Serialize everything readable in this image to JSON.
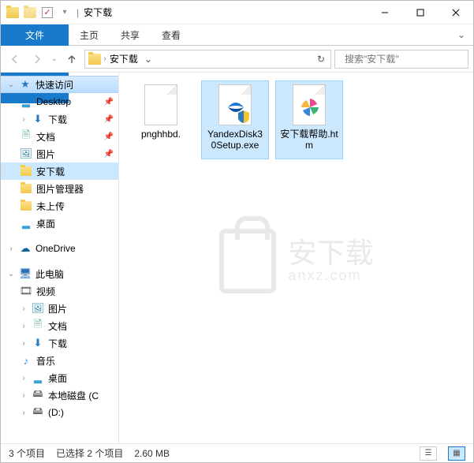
{
  "window": {
    "title": "安下载"
  },
  "ribbon": {
    "tabs": [
      "文件",
      "主页",
      "共享",
      "查看"
    ]
  },
  "address": {
    "path": [
      "安下载"
    ]
  },
  "search": {
    "placeholder": "搜索\"安下载\""
  },
  "nav": {
    "quick_access": "快速访问",
    "items": [
      "Desktop",
      "下载",
      "文档",
      "图片",
      "安下载",
      "图片管理器",
      "未上传",
      "桌面"
    ],
    "onedrive": "OneDrive",
    "this_pc": "此电脑",
    "pc_items": [
      "视频",
      "图片",
      "文档",
      "下载",
      "音乐",
      "桌面",
      "本地磁盘 (C",
      "(D:)"
    ]
  },
  "files": [
    {
      "name": "pnghhbd.",
      "selected": false
    },
    {
      "name": "YandexDisk30Setup.exe",
      "selected": true
    },
    {
      "name": "安下载帮助.htm",
      "selected": true
    }
  ],
  "status": {
    "count": "3 个项目",
    "selected": "已选择 2 个项目",
    "size": "2.60 MB"
  },
  "watermark": {
    "text": "安下载",
    "sub": "anxz.com"
  }
}
